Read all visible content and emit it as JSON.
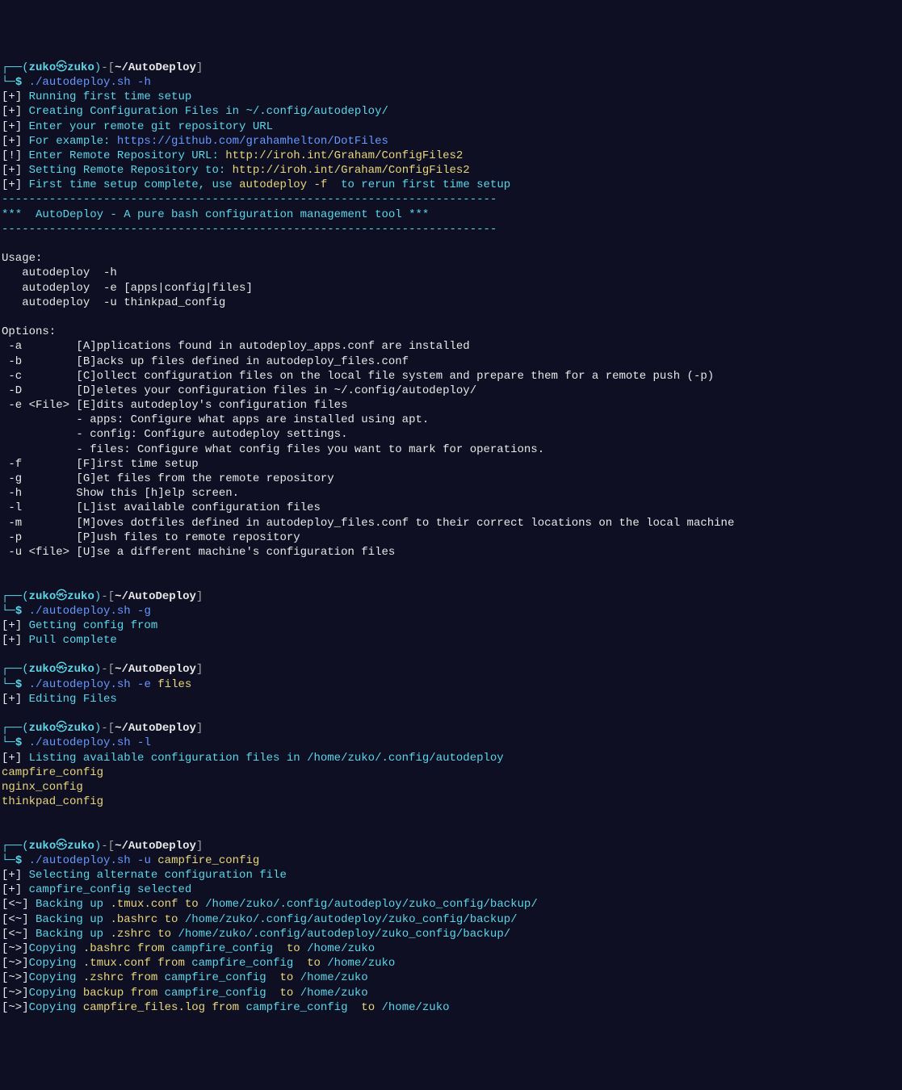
{
  "prompt": {
    "open_corner": "┌──",
    "paren_open": "(",
    "user": "zuko",
    "icon": "㉿",
    "host": "zuko",
    "paren_close": ")",
    "dash": "-",
    "bracket_open": "[",
    "path": "~/AutoDeploy",
    "bracket_close": "]",
    "line2_prefix": "└─",
    "dollar": "$"
  },
  "cmd1": "./autodeploy.sh -h",
  "setup": {
    "l1_tag": "[+] ",
    "l1": "Running first time setup",
    "l2_tag": "[+] ",
    "l2": "Creating Configuration Files in ~/.config/autodeploy/",
    "l3_tag": "[+] ",
    "l3": "Enter your remote git repository URL",
    "l4_tag": "[+] ",
    "l4a": "For example: ",
    "l4b": "https://github.com/grahamhelton/DotFiles",
    "l5_tag": "[!] ",
    "l5a": "Enter Remote Repository URL: ",
    "l5b": "http://iroh.int/Graham/ConfigFiles2",
    "l6_tag": "[+] ",
    "l6a": "Setting Remote Repository to: ",
    "l6b": "http://iroh.int/Graham/ConfigFiles2",
    "l7_tag": "[+] ",
    "l7a": "First time setup complete, use ",
    "l7b": "autodeploy -f ",
    "l7c": " to rerun first time setup"
  },
  "divider": "-------------------------------------------------------------------------",
  "banner": "***  AutoDeploy - A pure bash configuration management tool ***",
  "usage": {
    "title": "Usage:",
    "u1": "   autodeploy  -h ",
    "u2": "   autodeploy  -e [apps|config|files]",
    "u3": "   autodeploy  -u thinkpad_config"
  },
  "options": {
    "title": "Options:",
    "a": " -a        [A]pplications found in autodeploy_apps.conf are installed",
    "b": " -b        [B]acks up files defined in autodeploy_files.conf",
    "c": " -c        [C]ollect configuration files on the local file system and prepare them for a remote push (-p)",
    "D": " -D        [D]eletes your configuration files in ~/.config/autodeploy/",
    "e": " -e <File> [E]dits autodeploy's configuration files",
    "e1": "           - apps: Configure what apps are installed using apt.",
    "e2": "           - config: Configure autodeploy settings.",
    "e3": "           - files: Configure what config files you want to mark for operations.",
    "f": " -f        [F]irst time setup",
    "g": " -g        [G]et files from the remote repository",
    "h": " -h        Show this [h]elp screen.",
    "l": " -l        [L]ist available configuration files",
    "m": " -m        [M]oves dotfiles defined in autodeploy_files.conf to their correct locations on the local machine",
    "p": " -p        [P]ush files to remote repository",
    "u": " -u <file> [U]se a different machine's configuration files"
  },
  "cmd2": "./autodeploy.sh -g",
  "block2": {
    "l1_tag": "[+] ",
    "l1": "Getting config from ",
    "l2_tag": "[+] ",
    "l2": "Pull complete"
  },
  "cmd3a": "./autodeploy.sh -e",
  "cmd3b": " files",
  "block3": {
    "l1_tag": "[+] ",
    "l1": "Editing Files"
  },
  "cmd4": "./autodeploy.sh -l",
  "block4": {
    "l1_tag": "[+] ",
    "l1": "Listing available configuration files in /home/zuko/.config/autodeploy",
    "f1": "campfire_config",
    "f2": "nginx_config",
    "f3": "thinkpad_config"
  },
  "cmd5a": "./autodeploy.sh -u",
  "cmd5b": " campfire_config",
  "block5": {
    "l1_tag": "[+] ",
    "l1": "Selecting alternate configuration file",
    "l2_tag": "[+] ",
    "l2": "campfire_config selected",
    "b1_tag": "[<~] ",
    "b1a": "Backing up ",
    "b1b": ".tmux.conf to ",
    "b1c": "/home/zuko/.config/autodeploy/zuko_config/backup/",
    "b2_tag": "[<~] ",
    "b2a": "Backing up ",
    "b2b": ".bashrc to ",
    "b2c": "/home/zuko/.config/autodeploy/zuko_config/backup/",
    "b3_tag": "[<~] ",
    "b3a": "Backing up ",
    "b3b": ".zshrc to ",
    "b3c": "/home/zuko/.config/autodeploy/zuko_config/backup/",
    "c1_tag": "[~>]",
    "c1a": "Copying ",
    "c1b": ".bashrc from ",
    "c1c": "campfire_config ",
    "c1d": " to ",
    "c1e": "/home/zuko",
    "c2_tag": "[~>]",
    "c2a": "Copying ",
    "c2b": ".tmux.conf from ",
    "c2c": "campfire_config ",
    "c2d": " to ",
    "c2e": "/home/zuko",
    "c3_tag": "[~>]",
    "c3a": "Copying ",
    "c3b": ".zshrc from ",
    "c3c": "campfire_config ",
    "c3d": " to ",
    "c3e": "/home/zuko",
    "c4_tag": "[~>]",
    "c4a": "Copying ",
    "c4b": "backup from ",
    "c4c": "campfire_config ",
    "c4d": " to ",
    "c4e": "/home/zuko",
    "c5_tag": "[~>]",
    "c5a": "Copying ",
    "c5b": "campfire_files.log from ",
    "c5c": "campfire_config ",
    "c5d": " to ",
    "c5e": "/home/zuko"
  }
}
